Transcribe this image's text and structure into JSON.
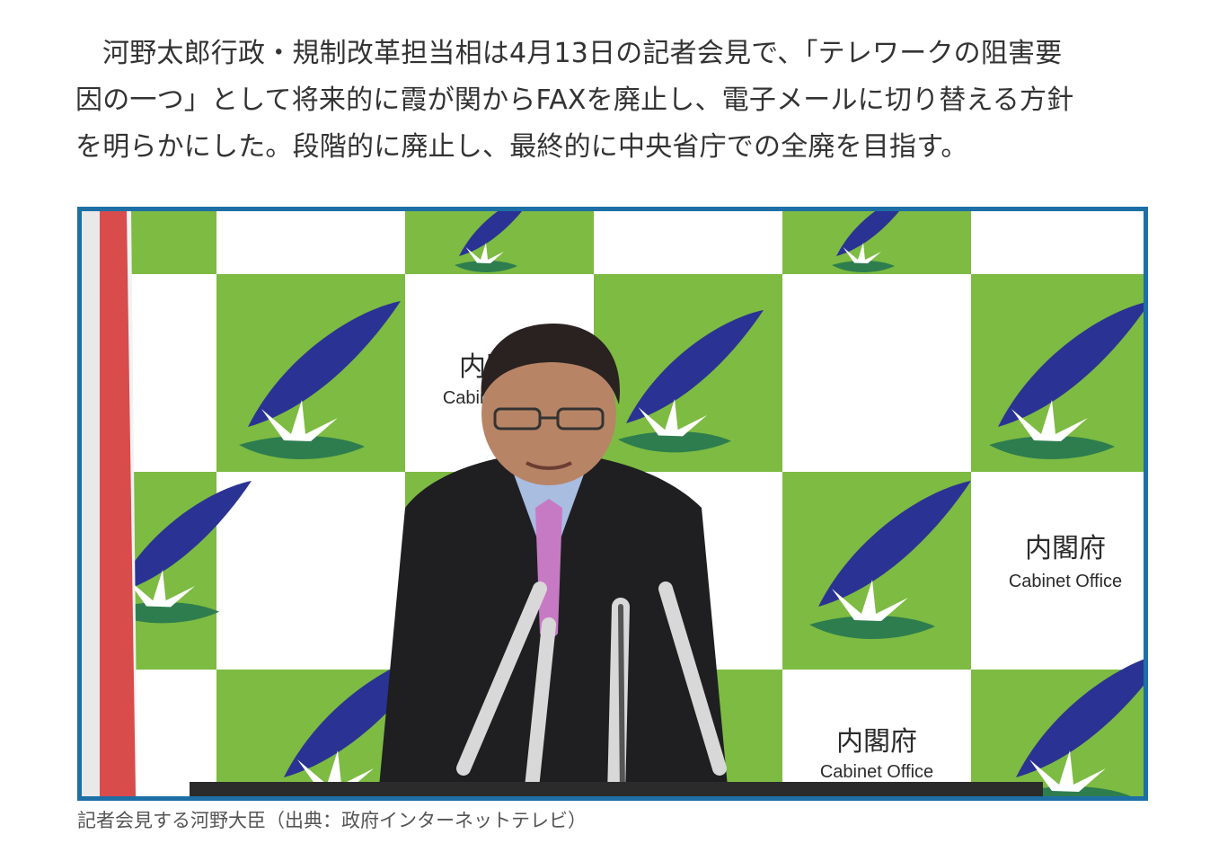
{
  "article": {
    "lines": [
      "河野太郎行政・規制改革担当相は4月13日の記者会見で、「テレワークの阻害要",
      "因の一つ」として将来的に霞が関からFAXを廃止し、電子メールに切り替える方針",
      "を明らかにした。段階的に廃止し、最終的に中央省庁での全廃を目指す。"
    ]
  },
  "figure": {
    "backdrop_labels": {
      "jp": "内閣府",
      "en": "Cabinet Office"
    },
    "caption": "記者会見する河野大臣（出典：政府インターネットテレビ）"
  },
  "colors": {
    "frame_border": "#1d6fa5",
    "backdrop_green": "#7dbb42",
    "logo_navy": "#2a3393",
    "logo_green": "#2e7d4f",
    "flag_red": "#d32f2f"
  }
}
